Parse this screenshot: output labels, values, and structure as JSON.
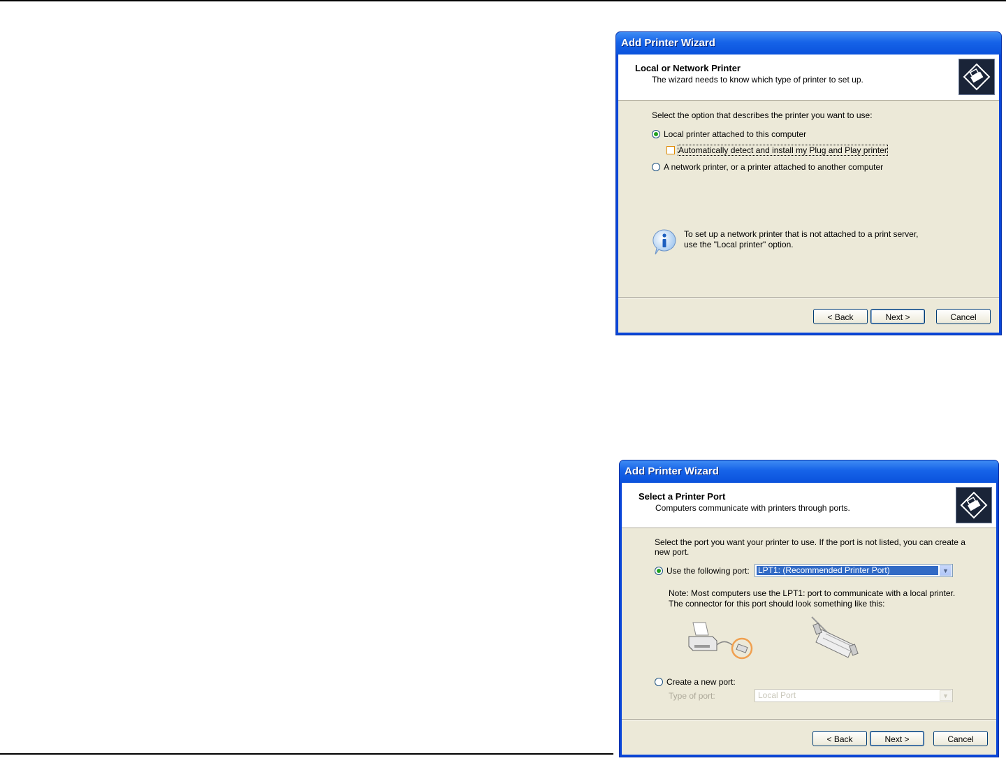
{
  "dialog1": {
    "title": "Add Printer Wizard",
    "header_title": "Local or Network Printer",
    "header_sub": "The wizard needs to know which type of printer to set up.",
    "prompt": "Select the option that describes the printer you want to use:",
    "option_local": "Local printer attached to this computer",
    "option_auto_detect": "Automatically detect and install my Plug and Play printer",
    "option_network": "A network printer, or a printer attached to another computer",
    "info_line1": "To set up a network printer that is not attached to a print server,",
    "info_line2": "use the \"Local printer\" option.",
    "buttons": {
      "back": "< Back",
      "next": "Next >",
      "cancel": "Cancel"
    }
  },
  "dialog2": {
    "title": "Add Printer Wizard",
    "header_title": "Select a Printer Port",
    "header_sub": "Computers communicate with printers through ports.",
    "prompt_line1": "Select the port you want your printer to use.  If the port is not listed, you can create a",
    "prompt_line2": "new port.",
    "use_port_label": "Use the following port:",
    "port_value": "LPT1: (Recommended Printer Port)",
    "note_line1": "Note: Most computers use the LPT1: port to communicate with a local printer.",
    "note_line2": "The connector for this port should look something like this:",
    "create_port_label": "Create a new port:",
    "type_of_port_label": "Type of port:",
    "type_of_port_value": "Local Port",
    "buttons": {
      "back": "< Back",
      "next": "Next >",
      "cancel": "Cancel"
    }
  },
  "colors": {
    "titlebar": "#0a52dc",
    "client": "#ece9d8",
    "selection": "#316ac5"
  }
}
